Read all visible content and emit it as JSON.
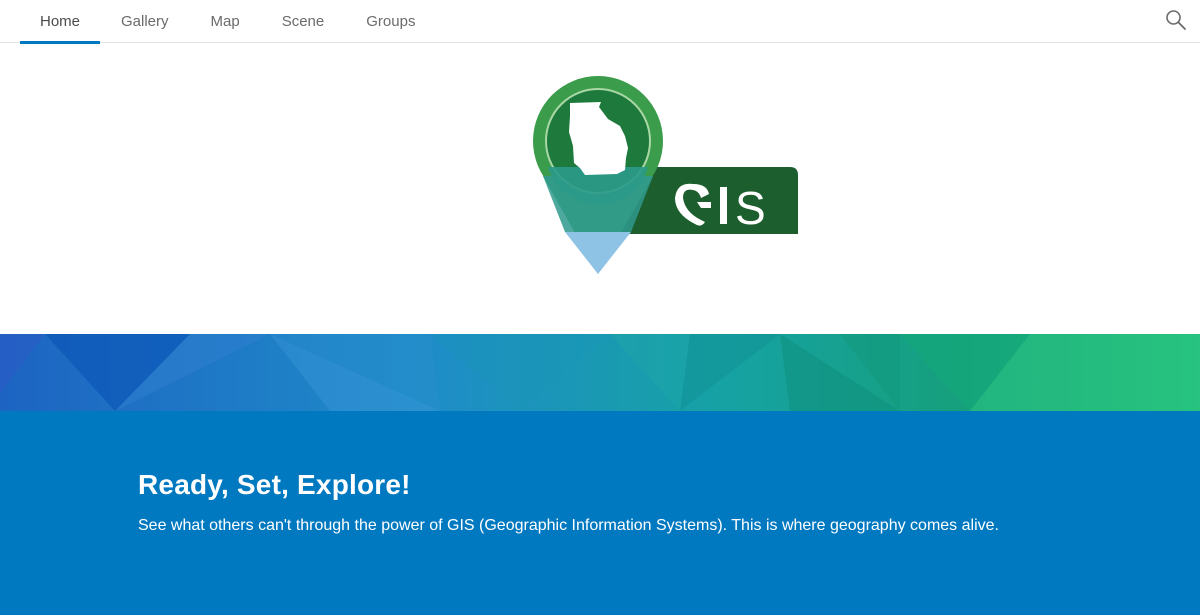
{
  "nav": {
    "tabs": [
      {
        "label": "Home",
        "active": true
      },
      {
        "label": "Gallery",
        "active": false
      },
      {
        "label": "Map",
        "active": false
      },
      {
        "label": "Scene",
        "active": false
      },
      {
        "label": "Groups",
        "active": false
      }
    ],
    "search_icon": "search-icon"
  },
  "logo": {
    "text": "GIS",
    "icon": "map-pin-georgia-icon",
    "colors": {
      "pin_outer": "#3b9c4b",
      "pin_inner": "#1e7a3c",
      "label_bg": "#1d5e2e",
      "pin_tip": "#8ec3e6"
    }
  },
  "hero": {
    "title": "Ready, Set, Explore!",
    "subtitle": "See what others can't through the power of GIS (Geographic Information Systems). This is where geography comes alive.",
    "background": "#0079c1"
  }
}
